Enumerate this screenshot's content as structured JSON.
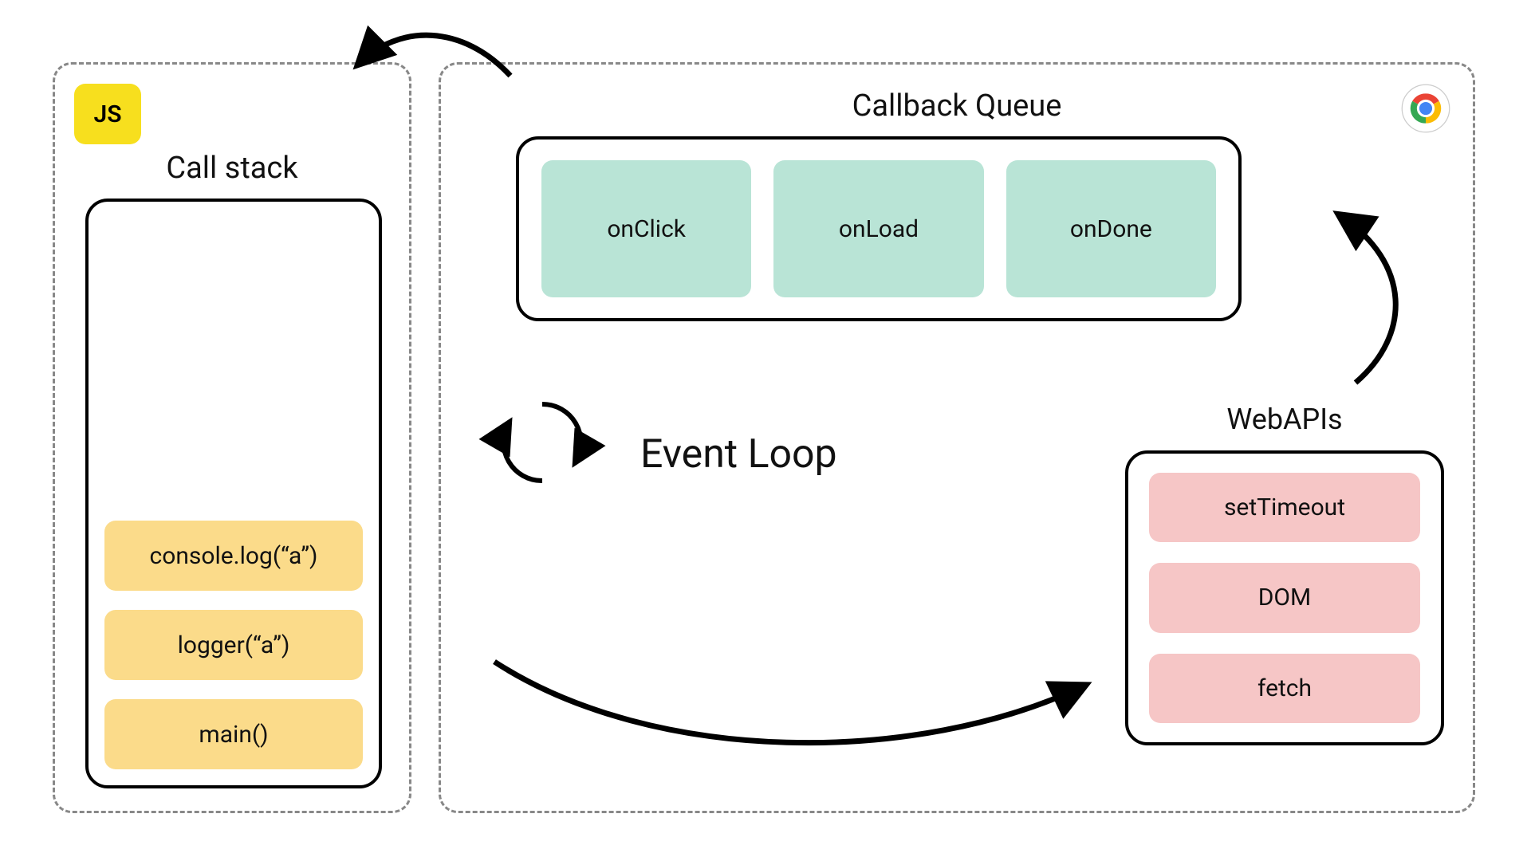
{
  "js_panel": {
    "badge": "JS",
    "title": "Call stack",
    "stack": [
      "console.log(“a”)",
      "logger(“a”)",
      "main()"
    ]
  },
  "browser_panel": {
    "queue_title": "Callback Queue",
    "queue": [
      "onClick",
      "onLoad",
      "onDone"
    ],
    "event_loop_label": "Event Loop",
    "webapis_title": "WebAPIs",
    "webapis": [
      "setTimeout",
      "DOM",
      "fetch"
    ]
  },
  "colors": {
    "js_badge_bg": "#f7df1e",
    "stack_frame_bg": "#fbdb8a",
    "queue_item_bg": "#b9e4d6",
    "webapi_item_bg": "#f6c6c6",
    "dash_border": "#888888"
  }
}
